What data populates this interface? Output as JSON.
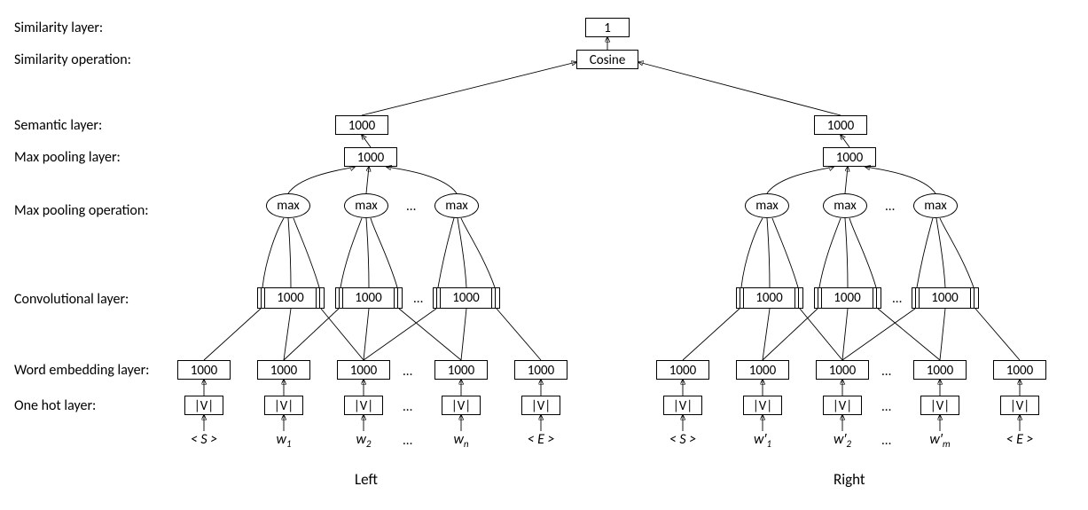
{
  "domain": "Diagram",
  "description": "Architecture diagram of a Siamese CNN similarity model: two identical branches (Left, Right) map token sequences through one-hot, word embedding, convolution, max-pooling and a semantic layer, then compared by cosine similarity.",
  "rows": {
    "similarity_layer": "Similarity layer:",
    "similarity_op": "Similarity operation:",
    "semantic": "Semantic layer:",
    "maxpool_layer": "Max pooling layer:",
    "maxpool_op": "Max pooling operation:",
    "conv": "Convolutional layer:",
    "embed": "Word embedding layer:",
    "onehot": "One hot layer:"
  },
  "nodes": {
    "sim_out": "1",
    "cosine": "Cosine",
    "semantic": "1000",
    "maxpool": "1000",
    "max": "max",
    "conv": "1000",
    "embed": "1000",
    "onehot": "|V|"
  },
  "inputs_left": [
    "< 𝑆 >",
    "𝑤₁",
    "𝑤₂",
    "…",
    "𝑤ₙ",
    "< 𝐸 >"
  ],
  "inputs_right": [
    "< 𝑆 >",
    "𝑤′₁",
    "𝑤′₂",
    "…",
    "𝑤′ₘ",
    "< 𝐸 >"
  ],
  "inputs_left_plain": [
    "<S>",
    "w_1",
    "w_2",
    "...",
    "w_n",
    "<E>"
  ],
  "inputs_right_plain": [
    "<S>",
    "w'_1",
    "w'_2",
    "...",
    "w'_m",
    "<E>"
  ],
  "sides": {
    "left": "Left",
    "right": "Right"
  },
  "ellipsis": "...",
  "chart_data": {
    "type": "diagram",
    "layers": [
      {
        "name": "One hot layer",
        "dim": "|V|",
        "per_token": true
      },
      {
        "name": "Word embedding layer",
        "dim": 1000,
        "per_token": true
      },
      {
        "name": "Convolutional layer",
        "dim": 1000,
        "windows": 3,
        "window_size": 3
      },
      {
        "name": "Max pooling operation",
        "op": "max",
        "units": 3
      },
      {
        "name": "Max pooling layer",
        "dim": 1000
      },
      {
        "name": "Semantic layer",
        "dim": 1000
      },
      {
        "name": "Similarity operation",
        "op": "Cosine"
      },
      {
        "name": "Similarity layer",
        "dim": 1
      }
    ],
    "siamese_branches": [
      "Left",
      "Right"
    ],
    "inputs": {
      "Left": [
        "<S>",
        "w_1",
        "w_2",
        "...",
        "w_n",
        "<E>"
      ],
      "Right": [
        "<S>",
        "w'_1",
        "w'_2",
        "...",
        "w'_m",
        "<E>"
      ]
    }
  }
}
